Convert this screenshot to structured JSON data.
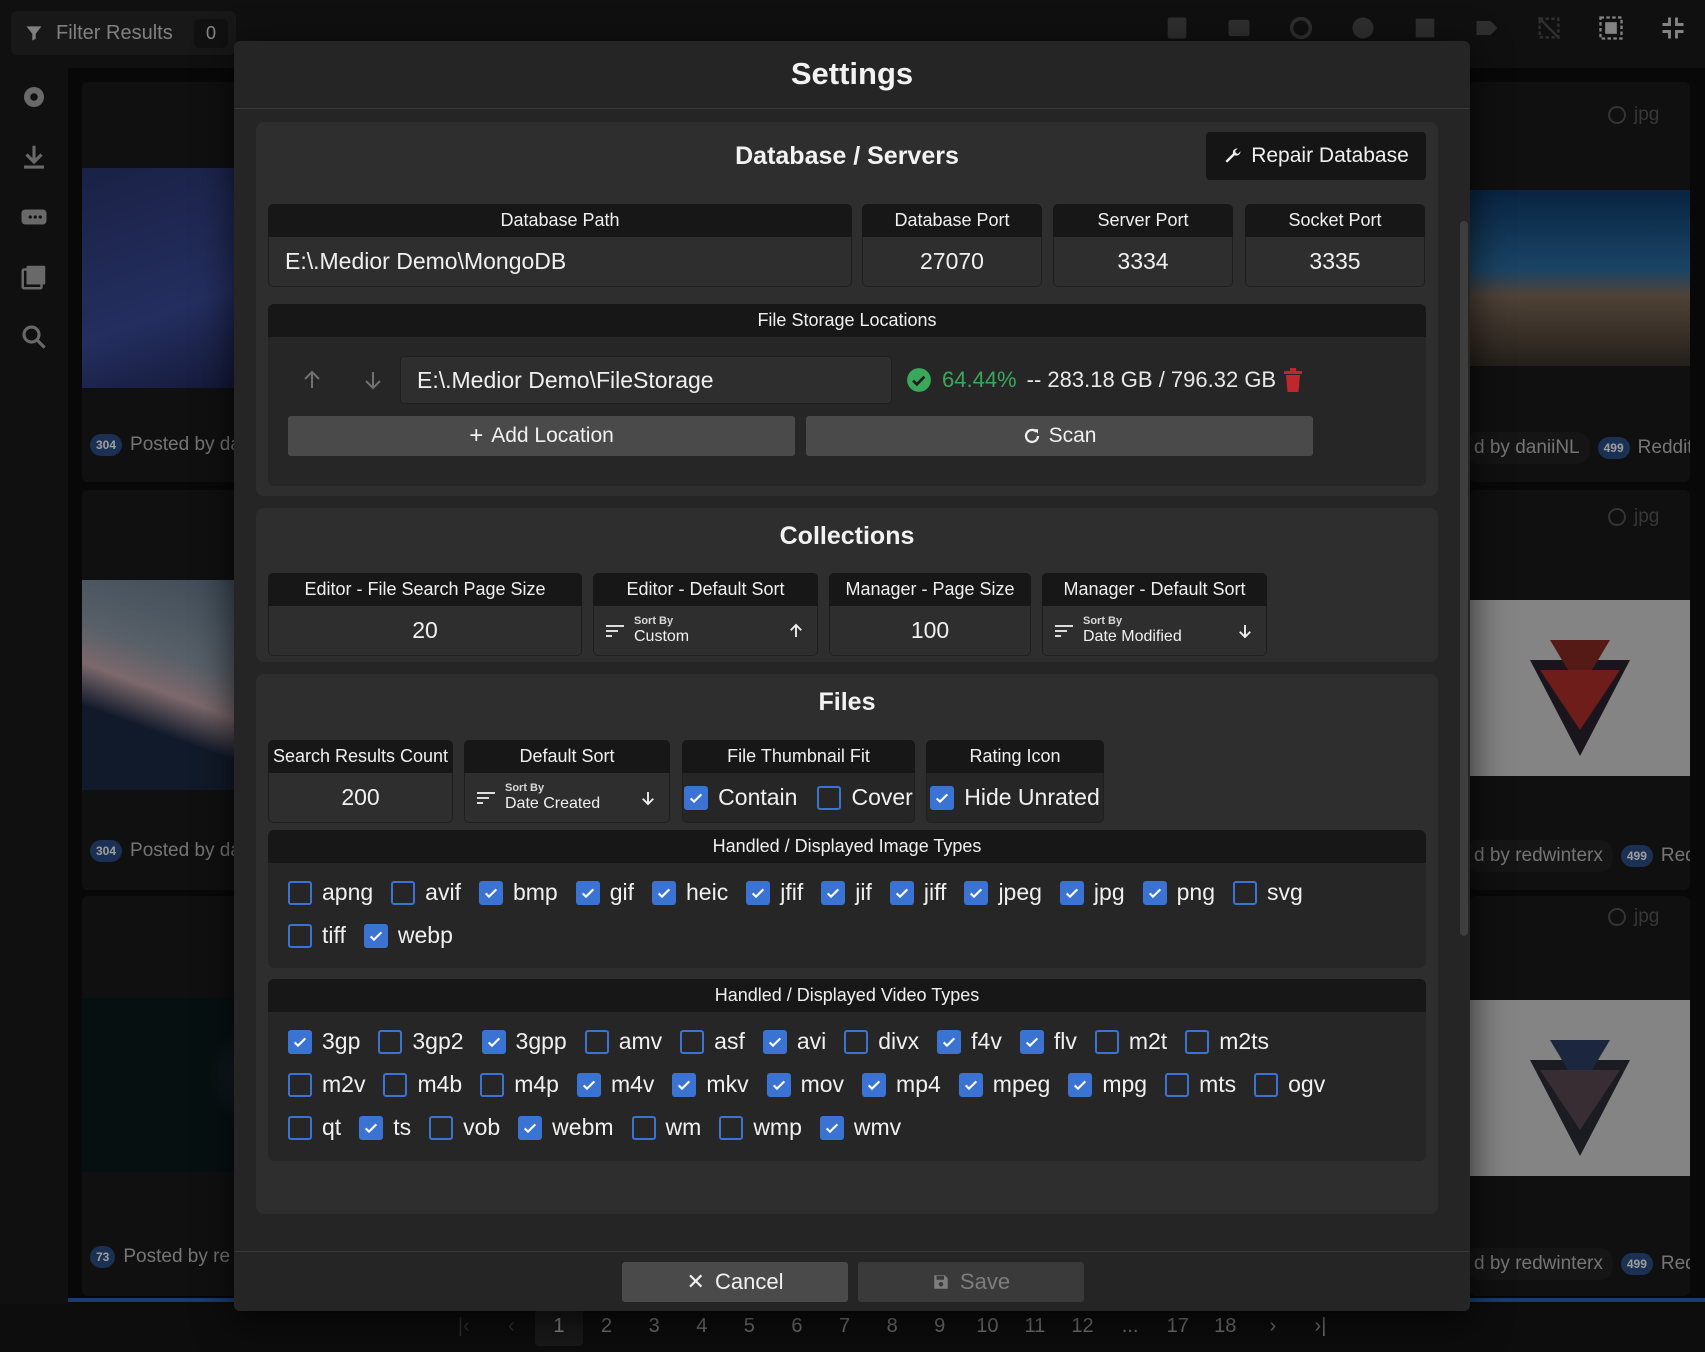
{
  "app": {
    "filter_label": "Filter Results",
    "filter_count": "0",
    "cards": [
      {
        "count": "304",
        "text": "Posted by da",
        "ext": "jpg",
        "right_author": "d by daniiNL",
        "right_count": "499",
        "right_source": "Reddit"
      },
      {
        "count": "304",
        "text": "Posted by da",
        "ext": "jpg",
        "right_author": "d by redwinterx",
        "right_count": "499",
        "right_source": "Redd"
      },
      {
        "count": "73",
        "text": "Posted by re",
        "ext": "jpg",
        "right_author": "d by redwinterx",
        "right_count": "499",
        "right_source": "Redd"
      }
    ],
    "pagination": [
      "1",
      "2",
      "3",
      "4",
      "5",
      "6",
      "7",
      "8",
      "9",
      "10",
      "11",
      "12",
      "...",
      "17",
      "18"
    ]
  },
  "dialog": {
    "title": "Settings",
    "database": {
      "title": "Database / Servers",
      "repair_label": "Repair Database",
      "path_label": "Database Path",
      "path_value": "E:\\.Medior Demo\\MongoDB",
      "db_port_label": "Database Port",
      "db_port_value": "27070",
      "server_port_label": "Server Port",
      "server_port_value": "3334",
      "socket_port_label": "Socket Port",
      "socket_port_value": "3335",
      "storage_label": "File Storage Locations",
      "location_path": "E:\\.Medior Demo\\FileStorage",
      "location_percent": "64.44%",
      "location_usage": "-- 283.18 GB / 796.32 GB",
      "add_location_label": "Add Location",
      "scan_label": "Scan"
    },
    "collections": {
      "title": "Collections",
      "editor_page_size_label": "Editor - File Search Page Size",
      "editor_page_size_value": "20",
      "editor_sort_label": "Editor - Default Sort",
      "editor_sort_caption": "Sort By",
      "editor_sort_value": "Custom",
      "manager_page_size_label": "Manager - Page Size",
      "manager_page_size_value": "100",
      "manager_sort_label": "Manager - Default Sort",
      "manager_sort_caption": "Sort By",
      "manager_sort_value": "Date Modified"
    },
    "files": {
      "title": "Files",
      "search_count_label": "Search Results Count",
      "search_count_value": "200",
      "default_sort_label": "Default Sort",
      "default_sort_caption": "Sort By",
      "default_sort_value": "Date Created",
      "thumb_fit_label": "File Thumbnail Fit",
      "contain_label": "Contain",
      "contain_checked": true,
      "cover_label": "Cover",
      "cover_checked": false,
      "rating_icon_label": "Rating Icon",
      "hide_unrated_label": "Hide Unrated",
      "hide_unrated_checked": true,
      "image_types_label": "Handled / Displayed Image Types",
      "image_types": [
        [
          {
            "label": "apng",
            "checked": false
          },
          {
            "label": "avif",
            "checked": false
          },
          {
            "label": "bmp",
            "checked": true
          },
          {
            "label": "gif",
            "checked": true
          },
          {
            "label": "heic",
            "checked": true
          },
          {
            "label": "jfif",
            "checked": true
          },
          {
            "label": "jif",
            "checked": true
          },
          {
            "label": "jiff",
            "checked": true
          },
          {
            "label": "jpeg",
            "checked": true
          },
          {
            "label": "jpg",
            "checked": true
          },
          {
            "label": "png",
            "checked": true
          },
          {
            "label": "svg",
            "checked": false
          }
        ],
        [
          {
            "label": "tiff",
            "checked": false
          },
          {
            "label": "webp",
            "checked": true
          }
        ]
      ],
      "video_types_label": "Handled / Displayed Video Types",
      "video_types": [
        [
          {
            "label": "3gp",
            "checked": true
          },
          {
            "label": "3gp2",
            "checked": false
          },
          {
            "label": "3gpp",
            "checked": true
          },
          {
            "label": "amv",
            "checked": false
          },
          {
            "label": "asf",
            "checked": false
          },
          {
            "label": "avi",
            "checked": true
          },
          {
            "label": "divx",
            "checked": false
          },
          {
            "label": "f4v",
            "checked": true
          },
          {
            "label": "flv",
            "checked": true
          },
          {
            "label": "m2t",
            "checked": false
          },
          {
            "label": "m2ts",
            "checked": false
          }
        ],
        [
          {
            "label": "m2v",
            "checked": false
          },
          {
            "label": "m4b",
            "checked": false
          },
          {
            "label": "m4p",
            "checked": false
          },
          {
            "label": "m4v",
            "checked": true
          },
          {
            "label": "mkv",
            "checked": true
          },
          {
            "label": "mov",
            "checked": true
          },
          {
            "label": "mp4",
            "checked": true
          },
          {
            "label": "mpeg",
            "checked": true
          },
          {
            "label": "mpg",
            "checked": true
          },
          {
            "label": "mts",
            "checked": false
          },
          {
            "label": "ogv",
            "checked": false
          }
        ],
        [
          {
            "label": "qt",
            "checked": false
          },
          {
            "label": "ts",
            "checked": true
          },
          {
            "label": "vob",
            "checked": false
          },
          {
            "label": "webm",
            "checked": true
          },
          {
            "label": "wm",
            "checked": false
          },
          {
            "label": "wmp",
            "checked": false
          },
          {
            "label": "wmv",
            "checked": true
          }
        ]
      ]
    },
    "footer": {
      "cancel_label": "Cancel",
      "save_label": "Save"
    }
  }
}
